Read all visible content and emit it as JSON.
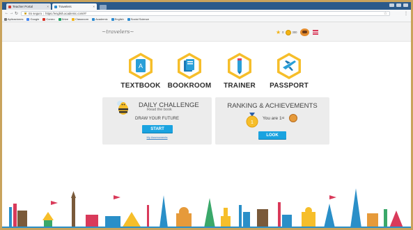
{
  "browser": {
    "tabs": [
      {
        "label": "Teacher Portal",
        "active": false
      },
      {
        "label": "Travelers",
        "active": true
      }
    ],
    "url": "https://english.academic.com/#/",
    "url_prefix": "Es seguro",
    "bookmarks": [
      "Aplicaciones",
      "Google",
      "Correo",
      "Drive",
      "Classroom",
      "Academic",
      "English",
      "Social Science"
    ]
  },
  "header": {
    "logo": "~travelers~",
    "stars_count": "0",
    "coins_count": "300"
  },
  "nav": [
    {
      "label": "TEXTBOOK",
      "icon": "textbook-icon"
    },
    {
      "label": "BOOKROOM",
      "icon": "bookroom-icon"
    },
    {
      "label": "TRAINER",
      "icon": "trainer-icon"
    },
    {
      "label": "PASSPORT",
      "icon": "passport-icon"
    }
  ],
  "daily_challenge": {
    "title": "DAILY CHALLENGE",
    "subtitle": "Read the book",
    "book_title": "DRAW YOUR FUTURE",
    "button": "START",
    "link": "My Assessments"
  },
  "ranking": {
    "title": "RANKING & ACHIEVEMENTS",
    "medal_number": "1",
    "text_prefix": "You are 1",
    "text_suffix": "st",
    "button": "LOOK"
  },
  "colors": {
    "accent": "#1aa3e0",
    "hex_fill": "#f6be2a",
    "panel_bg": "#ececec",
    "frame": "#c9a35c"
  }
}
